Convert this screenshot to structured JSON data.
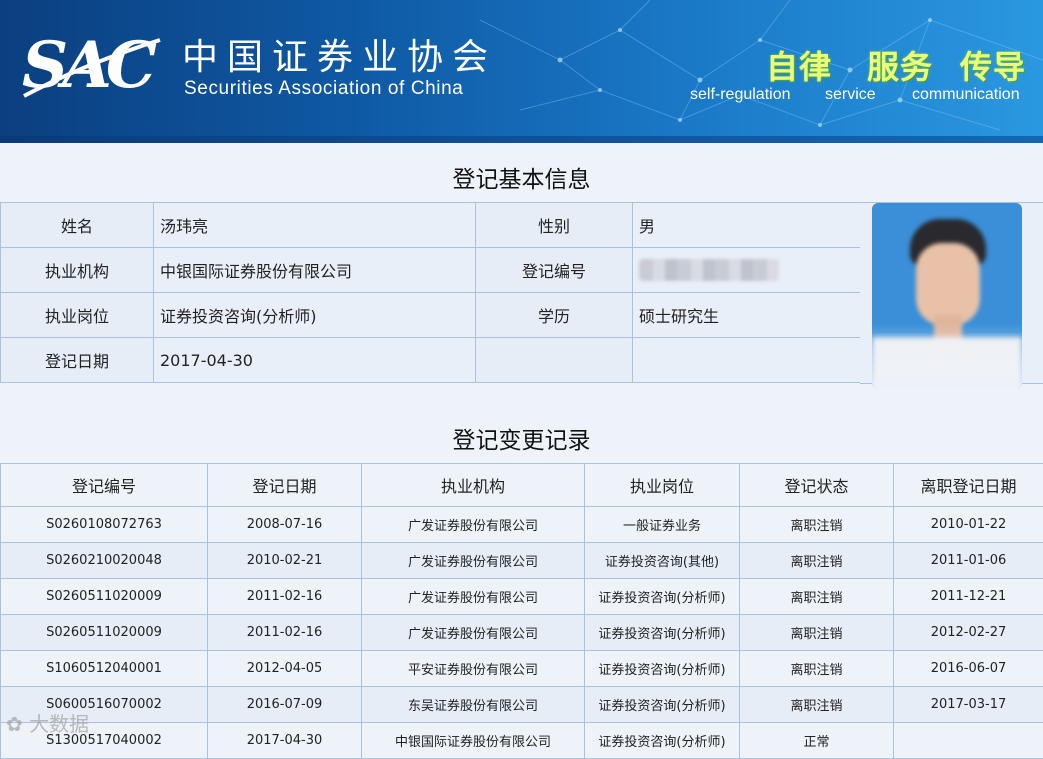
{
  "header": {
    "logo_text": "SAC",
    "org_cn": "中国证券业协会",
    "org_en": "Securities Association of China",
    "slogans": [
      {
        "cn": "自律",
        "en": "self-regulation"
      },
      {
        "cn": "服务",
        "en": "service"
      },
      {
        "cn": "传导",
        "en": "communication"
      }
    ]
  },
  "basic_info": {
    "title": "登记基本信息",
    "rows": [
      {
        "label1": "姓名",
        "value1": "汤玮亮",
        "label2": "性别",
        "value2": "男"
      },
      {
        "label1": "执业机构",
        "value1": "中银国际证券股份有限公司",
        "label2": "登记编号",
        "value2": ""
      },
      {
        "label1": "执业岗位",
        "value1": "证券投资咨询(分析师)",
        "label2": "学历",
        "value2": "硕士研究生"
      },
      {
        "label1": "登记日期",
        "value1": "2017-04-30",
        "label2": "",
        "value2": ""
      }
    ]
  },
  "change_records": {
    "title": "登记变更记录",
    "columns": [
      "登记编号",
      "登记日期",
      "执业机构",
      "执业岗位",
      "登记状态",
      "离职登记日期"
    ],
    "rows": [
      [
        "S0260108072763",
        "2008-07-16",
        "广发证券股份有限公司",
        "一般证券业务",
        "离职注销",
        "2010-01-22"
      ],
      [
        "S0260210020048",
        "2010-02-21",
        "广发证券股份有限公司",
        "证券投资咨询(其他)",
        "离职注销",
        "2011-01-06"
      ],
      [
        "S0260511020009",
        "2011-02-16",
        "广发证券股份有限公司",
        "证券投资咨询(分析师)",
        "离职注销",
        "2011-12-21"
      ],
      [
        "S0260511020009",
        "2011-02-16",
        "广发证券股份有限公司",
        "证券投资咨询(分析师)",
        "离职注销",
        "2012-02-27"
      ],
      [
        "S1060512040001",
        "2012-04-05",
        "平安证券股份有限公司",
        "证券投资咨询(分析师)",
        "离职注销",
        "2016-06-07"
      ],
      [
        "S0600516070002",
        "2016-07-09",
        "东吴证券股份有限公司",
        "证券投资咨询(分析师)",
        "离职注销",
        "2017-03-17"
      ],
      [
        "S1300517040002",
        "2017-04-30",
        "中银国际证券股份有限公司",
        "证券投资咨询(分析师)",
        "正常",
        ""
      ]
    ]
  },
  "watermark_text": "大数据"
}
